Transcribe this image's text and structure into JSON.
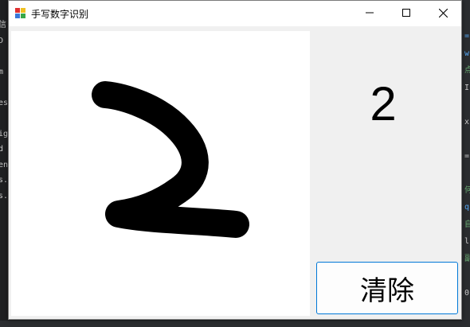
{
  "window": {
    "title": "手写数字识别",
    "controls": {
      "minimize_icon": "minimize-icon",
      "maximize_icon": "maximize-icon",
      "close_icon": "close-icon"
    }
  },
  "canvas": {
    "drawn_glyph": "handwritten-2",
    "stroke_color": "#000000",
    "background_color": "#ffffff"
  },
  "result": {
    "prediction": "2"
  },
  "buttons": {
    "clear_label": "清除"
  },
  "background_fragments": {
    "left": [
      "信",
      "D",
      "",
      "m",
      "",
      "es",
      "",
      "ig",
      "d",
      "en",
      "s.",
      "s.c"
    ],
    "right": [
      "=",
      "w",
      "点",
      "I",
      "",
      "x",
      "",
      "=",
      "",
      "何",
      "q",
      "自",
      "l",
      "副",
      "",
      "0"
    ]
  }
}
